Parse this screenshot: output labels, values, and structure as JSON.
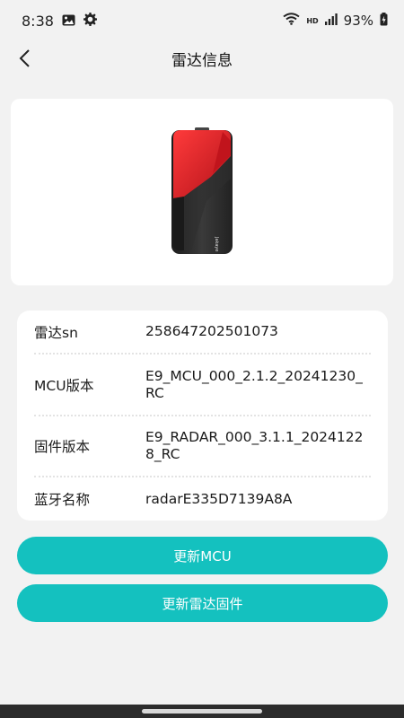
{
  "status": {
    "time": "8:38",
    "network": "HD",
    "battery": "93%"
  },
  "header": {
    "title": "雷达信息",
    "back_icon": "chevron-left-icon"
  },
  "device": {
    "image": "radar-device-image",
    "brand": "Jakaye"
  },
  "info": {
    "rows": [
      {
        "label": "雷达sn",
        "value": "258647202501073"
      },
      {
        "label": "MCU版本",
        "value": "E9_MCU_000_2.1.2_20241230_RC"
      },
      {
        "label": "固件版本",
        "value": "E9_RADAR_000_3.1.1_20241228_RC"
      },
      {
        "label": "蓝牙名称",
        "value": "radarE335D7139A8A"
      }
    ]
  },
  "actions": {
    "update_mcu": "更新MCU",
    "update_radar": "更新雷达固件"
  },
  "colors": {
    "accent": "#14c1bf",
    "device_red": "#e3202a",
    "device_black": "#2a2a2a"
  }
}
